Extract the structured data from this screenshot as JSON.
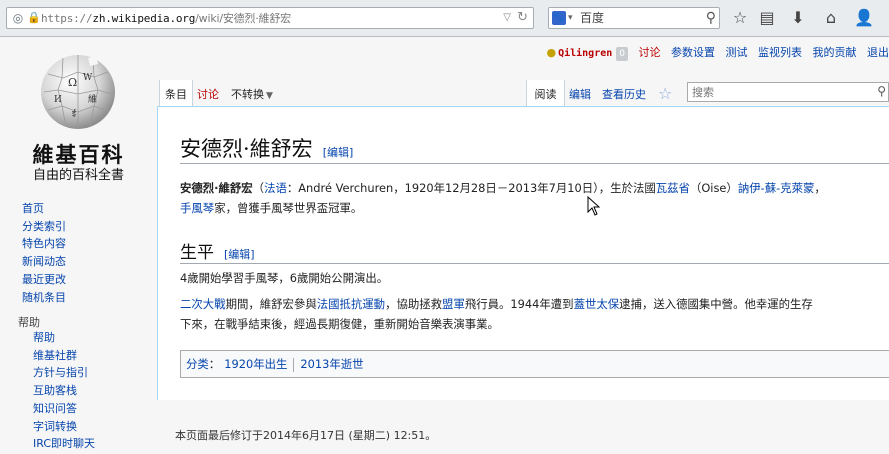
{
  "browser": {
    "url_scheme": "https://",
    "url_host": "zh.wikipedia.org",
    "url_path": "/wiki/安德烈·維舒宏",
    "search_engine": "百度",
    "toolbar_icons": [
      "bookmark-star-icon",
      "reading-list-icon",
      "download-icon",
      "home-icon",
      "account-icon"
    ]
  },
  "sidebar": {
    "wordmark": "維基百科",
    "tagline": "自由的百科全書",
    "nav": [
      "首页",
      "分类索引",
      "特色内容",
      "新闻动态",
      "最近更改",
      "随机条目"
    ],
    "help_heading": "帮助",
    "help": [
      "帮助",
      "维基社群",
      "方针与指引",
      "互助客栈",
      "知识问答",
      "字词转换",
      "IRC即时聊天"
    ]
  },
  "personal": {
    "username": "Qilingren",
    "notice_count": "0",
    "links": [
      "讨论",
      "参数设置",
      "测试",
      "监视列表",
      "我的贡献",
      "退出"
    ]
  },
  "tabs": {
    "article": "条目",
    "talk": "讨论",
    "variant": "不转换",
    "read": "阅读",
    "edit": "编辑",
    "history": "查看历史",
    "search_placeholder": "搜索"
  },
  "article": {
    "title": "安德烈·維舒宏",
    "edit_label": "[编辑]",
    "lead": {
      "name": "安德烈·維舒宏",
      "lang_link": "法语",
      "original": "：André Verchuren，1920年12月28日－2013年7月10日），生於法國",
      "place1": "瓦茲省",
      "place_mid": "（Oise）",
      "place2": "訥伊-蘇-克萊蒙",
      "line2_link": "手風琴",
      "line2_rest": "家，曾獲手風琴世界盃冠軍。"
    },
    "section_title": "生平",
    "section_edit": "[编辑]",
    "para1": "4歲開始學習手風琴，6歲開始公開演出。",
    "para2": {
      "link1": "二次大戰",
      "t1": "期間，維舒宏參與",
      "link2": "法國抵抗運動",
      "t2": "，協助拯救",
      "link3": "盟軍",
      "t3": "飛行員。1944年遭到",
      "link4": "蓋世太保",
      "t4": "逮捕，送入德國集中營。他幸運的生存",
      "line2": "下來，在戰爭結束後，經過長期復健，重新開始音樂表演事業。"
    },
    "categories_label": "分类",
    "categories": [
      "1920年出生",
      "2013年逝世"
    ]
  },
  "footer": "本页面最后修订于2014年6月17日 (星期二) 12:51。"
}
